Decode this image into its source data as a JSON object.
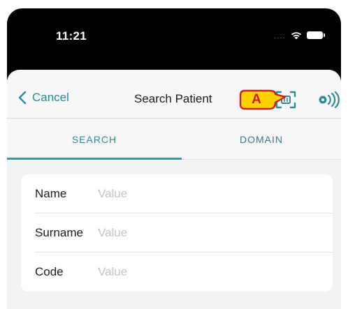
{
  "status_bar": {
    "time": "11:21",
    "signal_dots": "....",
    "icons": [
      "wifi-icon",
      "battery-icon"
    ]
  },
  "navbar": {
    "cancel_label": "Cancel",
    "title": "Search Patient",
    "icons": [
      "chevron-left-icon",
      "barcode-scan-icon",
      "nfc-icon"
    ]
  },
  "annotation": {
    "marker": "A"
  },
  "tabs": [
    {
      "label": "SEARCH",
      "active": true
    },
    {
      "label": "DOMAIN",
      "active": false
    }
  ],
  "form": {
    "fields": [
      {
        "label": "Name",
        "value": "",
        "placeholder": "Value"
      },
      {
        "label": "Surname",
        "value": "",
        "placeholder": "Value"
      },
      {
        "label": "Code",
        "value": "",
        "placeholder": "Value"
      }
    ]
  },
  "colors": {
    "accent": "#2f8a94",
    "tab_indicator": "#3a9aa3",
    "annotation_fill": "#ffd200",
    "annotation_outline": "#c62020"
  }
}
